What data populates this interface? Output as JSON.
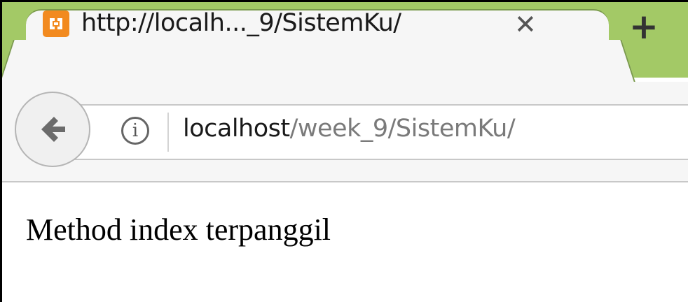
{
  "tab": {
    "title": "http://localh..._9/SistemKu/",
    "favicon_icon": "xampp-icon",
    "close_glyph": "✕",
    "new_tab_glyph": "+"
  },
  "toolbar": {
    "back_icon": "back-arrow-icon",
    "info_icon": "info-icon",
    "info_glyph": "i"
  },
  "address_bar": {
    "host": "localhost",
    "path": "/week_9/SistemKu/"
  },
  "page": {
    "text": "Method index terpanggil"
  },
  "colors": {
    "tabstrip": "#a3c966",
    "favicon": "#f28a1f",
    "url_host": "#1a1a1a",
    "url_path": "#7a7a7a"
  }
}
